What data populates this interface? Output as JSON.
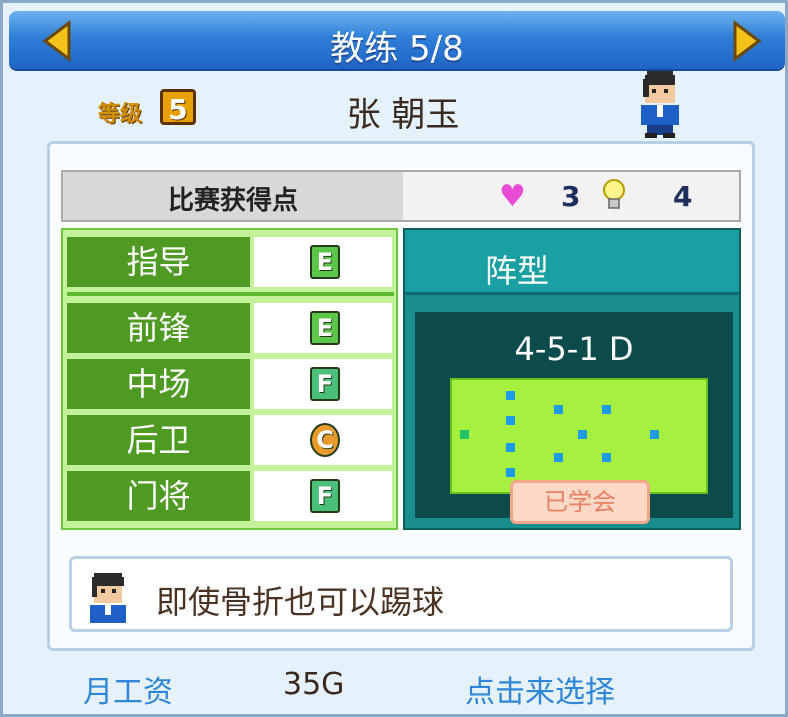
{
  "header": {
    "title": "教练 5/8",
    "prev_icon": "left-arrow-icon",
    "next_icon": "right-arrow-icon"
  },
  "coach": {
    "rank_label": "等级",
    "rank_value": "5",
    "name": "张 朝玉"
  },
  "match_points": {
    "label": "比赛获得点",
    "heart_value": "3",
    "bulb_value": "4"
  },
  "skills": [
    {
      "label": "指导",
      "grade": "E"
    },
    {
      "label": "前锋",
      "grade": "E"
    },
    {
      "label": "中场",
      "grade": "F"
    },
    {
      "label": "后卫",
      "grade": "C"
    },
    {
      "label": "门将",
      "grade": "F"
    }
  ],
  "formation": {
    "title": "阵型",
    "name": "4-5-1 D",
    "status": "已学会"
  },
  "trait": {
    "text": "即使骨折也可以踢球"
  },
  "footer": {
    "salary_label": "月工资",
    "salary_value": "35G",
    "action": "点击来选择"
  },
  "colors": {
    "title_bar": "#2f7fd8",
    "skill_green": "#4f9a23",
    "formation_teal": "#188e8f",
    "link_blue": "#2f86d8"
  }
}
